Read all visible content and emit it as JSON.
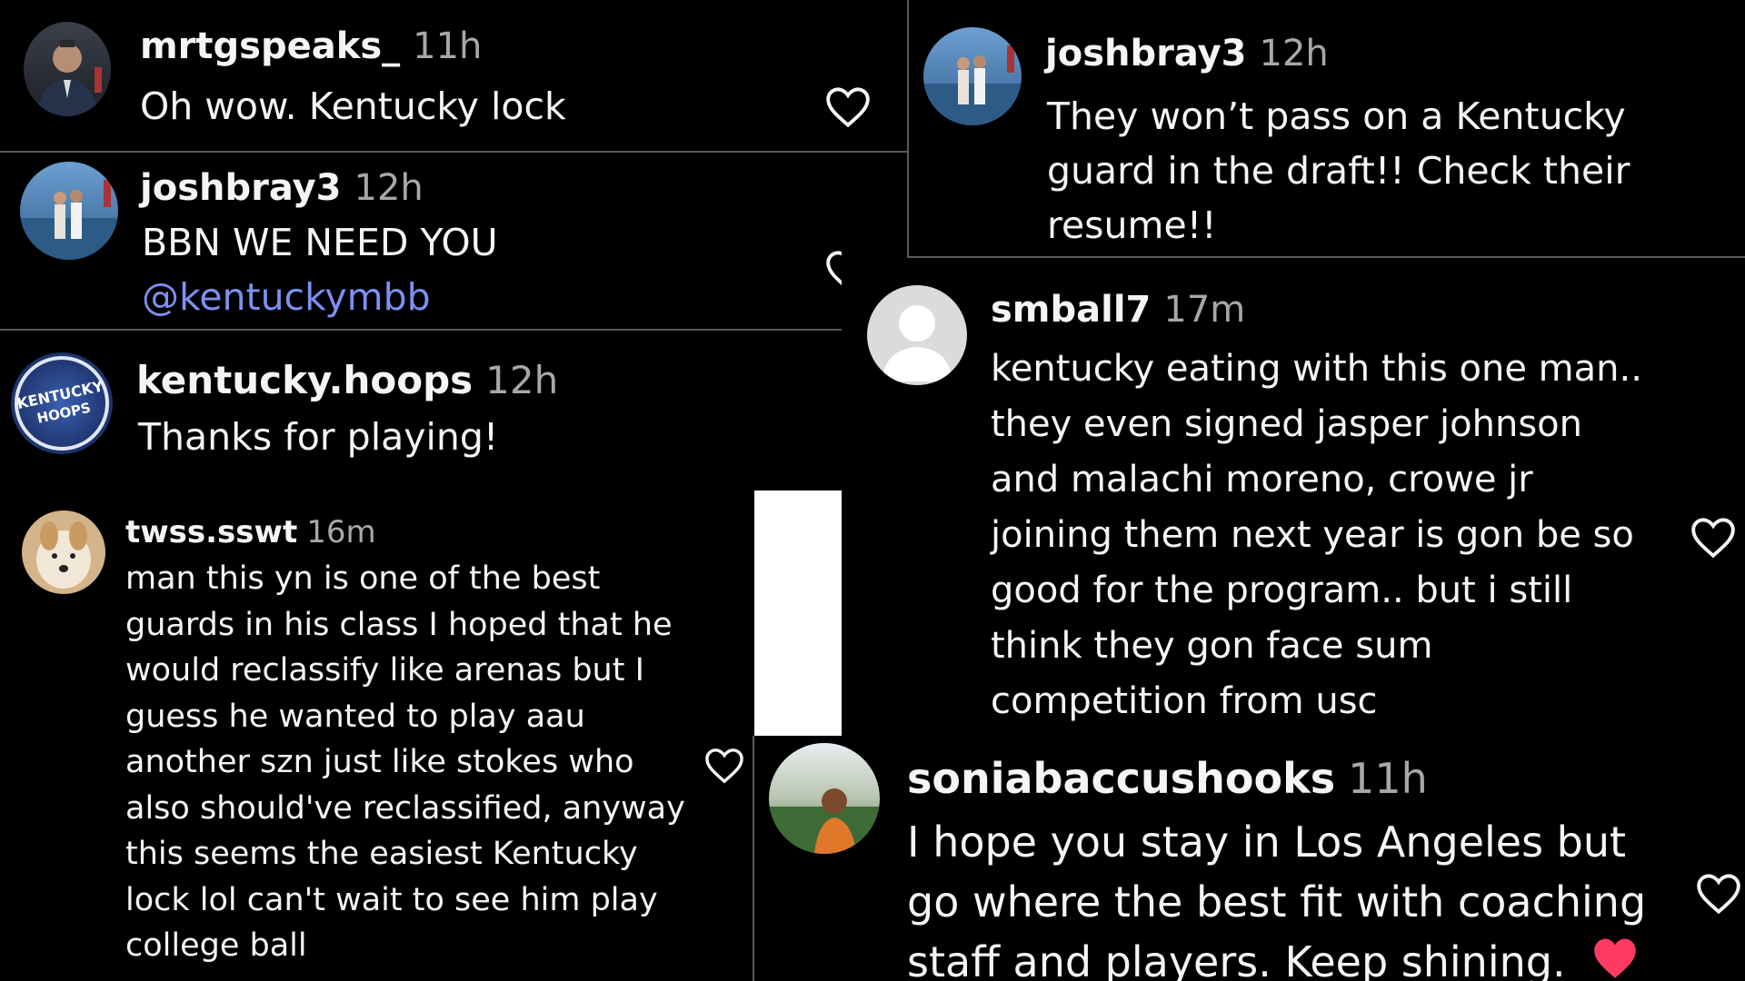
{
  "colors": {
    "background": "#000000",
    "text": "#f5f5f5",
    "muted": "#a8a8a8",
    "mention": "#7d90f0",
    "heart_red": "#ff3b63"
  },
  "comments": [
    {
      "username": "mrtgspeaks_",
      "time": "11h",
      "text": "Oh wow. Kentucky lock",
      "icon": "heart-outline-icon"
    },
    {
      "username": "joshbray3",
      "time": "12h",
      "text": "BBN WE NEED YOU",
      "mention": "@kentuckymbb",
      "icon": "heart-outline-icon"
    },
    {
      "username": "kentucky.hoops",
      "time": "12h",
      "text": "Thanks for playing!",
      "avatar_text_1": "KENTUCKY",
      "avatar_text_2": "HOOPS"
    },
    {
      "username": "twss.sswt",
      "time": "16m",
      "lines": [
        "man this yn is one of the best",
        "guards in his class I hoped that he",
        "would reclassify like arenas but I",
        "guess he wanted to play aau",
        "another szn just like stokes who",
        "also should've reclassified, anyway",
        "this seems the easiest Kentucky",
        "lock lol can't wait to see him play",
        "college ball"
      ],
      "icon": "heart-outline-icon"
    },
    {
      "username": "joshbray3",
      "time": "12h",
      "lines": [
        "They won’t pass on a Kentucky",
        "guard in the draft!! Check their",
        "resume!!"
      ]
    },
    {
      "username": "smball7",
      "time": "17m",
      "lines": [
        "kentucky eating with this one man..",
        "they even signed jasper johnson",
        "and malachi moreno, crowe jr",
        "joining them next year is gon be so",
        "good for the program.. but i still",
        "think they gon face sum",
        "competition from usc"
      ],
      "icon": "heart-outline-icon"
    },
    {
      "username": "soniabaccushooks",
      "time": "11h",
      "lines": [
        "I hope you stay in Los Angeles but",
        "go where the best fit with coaching",
        "staff and players. Keep shining."
      ],
      "icon": "heart-outline-icon",
      "emoji_icon": "red-heart-icon"
    }
  ]
}
